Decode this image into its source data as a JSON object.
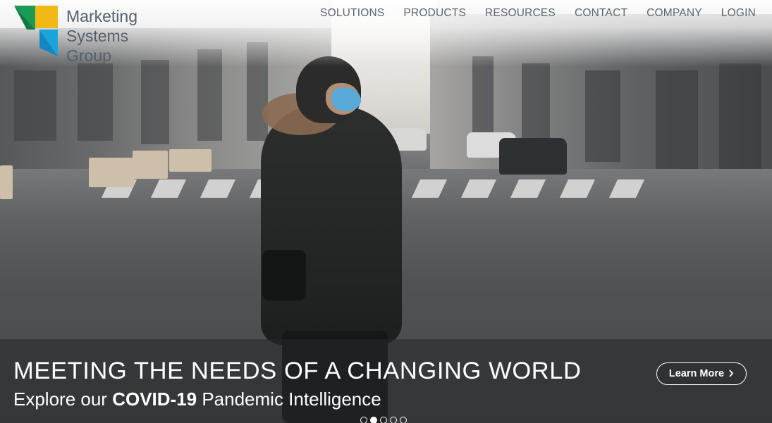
{
  "brand": {
    "logo_line1": "Marketing",
    "logo_line2": "Systems",
    "logo_line3": "Group",
    "colors": {
      "green": "#1a9a52",
      "yellow": "#f2b817",
      "blue": "#1ba3dc",
      "text": "#53606b"
    }
  },
  "nav": {
    "items": [
      {
        "label": "SOLUTIONS"
      },
      {
        "label": "PRODUCTS"
      },
      {
        "label": "RESOURCES"
      },
      {
        "label": "CONTACT"
      },
      {
        "label": "COMPANY"
      },
      {
        "label": "LOGIN"
      }
    ]
  },
  "hero": {
    "image_icon": "city-street-photo",
    "headline": "MEETING THE NEEDS OF A CHANGING WORLD",
    "subline_pre": "Explore our ",
    "subline_bold": "COVID-19",
    "subline_post": " Pandemic Intelligence",
    "cta_label": "Learn More",
    "cta_icon": "chevron-right-icon"
  },
  "carousel": {
    "slide_count": 5,
    "active_index": 1
  }
}
